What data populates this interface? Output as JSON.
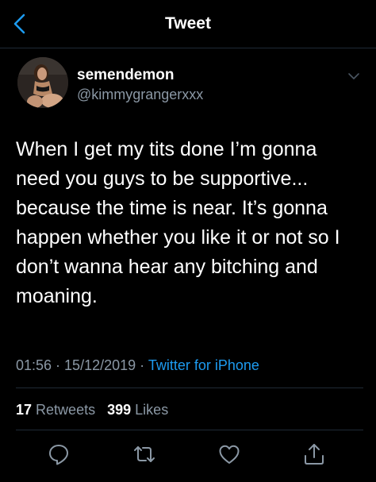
{
  "nav": {
    "title": "Tweet",
    "back_icon": "chevron-left-icon"
  },
  "author": {
    "display_name": "semendemon",
    "handle": "@kimmygrangerxxx"
  },
  "tweet": {
    "lines": [
      "When I get my tits done I’m gonna",
      "need you guys to be supportive...",
      "because the time is near. It’s gonna",
      "happen whether you like it or not so I",
      "don’t wanna hear any bitching and",
      "moaning."
    ],
    "time": "01:56",
    "date": "15/12/2019",
    "separator": " · ",
    "source": "Twitter for iPhone"
  },
  "stats": {
    "retweets_count": "17",
    "retweets_label": "Retweets",
    "likes_count": "399",
    "likes_label": "Likes"
  },
  "actions": [
    "reply-icon",
    "retweet-icon",
    "like-icon",
    "share-icon"
  ],
  "colors": {
    "background": "#000000",
    "text": "#ffffff",
    "secondary": "#8b98a5",
    "accent": "#1d9bf0",
    "divider": "#1f2a36"
  }
}
